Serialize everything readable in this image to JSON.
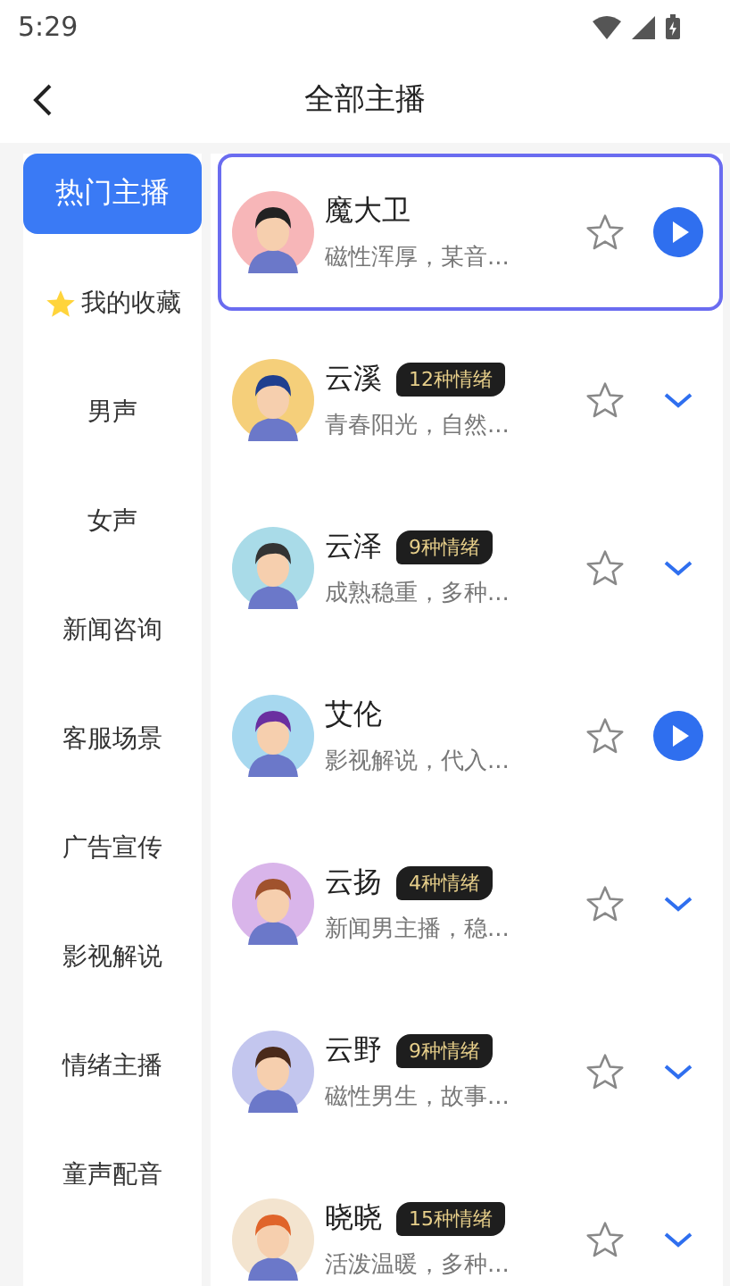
{
  "status_bar": {
    "time": "5:29"
  },
  "header": {
    "title": "全部主播"
  },
  "sidebar": {
    "items": [
      {
        "label": "热门主播",
        "selected": true,
        "kind": "plain"
      },
      {
        "label": "我的收藏",
        "selected": false,
        "kind": "favorites"
      },
      {
        "label": "男声",
        "selected": false,
        "kind": "plain"
      },
      {
        "label": "女声",
        "selected": false,
        "kind": "plain"
      },
      {
        "label": "新闻咨询",
        "selected": false,
        "kind": "plain"
      },
      {
        "label": "客服场景",
        "selected": false,
        "kind": "plain"
      },
      {
        "label": "广告宣传",
        "selected": false,
        "kind": "plain"
      },
      {
        "label": "影视解说",
        "selected": false,
        "kind": "plain"
      },
      {
        "label": "情绪主播",
        "selected": false,
        "kind": "plain"
      },
      {
        "label": "童声配音",
        "selected": false,
        "kind": "plain"
      }
    ]
  },
  "voices": [
    {
      "name": "魔大卫",
      "description": "磁性浑厚，某音...",
      "selected": true,
      "favorite": false,
      "kind": "play"
    },
    {
      "name": "云溪",
      "badge": "12种情绪",
      "description": "青春阳光，自然...",
      "selected": false,
      "favorite": false,
      "kind": "expand"
    },
    {
      "name": "云泽",
      "badge": "9种情绪",
      "description": "成熟稳重，多种...",
      "selected": false,
      "favorite": false,
      "kind": "expand"
    },
    {
      "name": "艾伦",
      "description": "影视解说，代入...",
      "selected": false,
      "favorite": false,
      "kind": "play"
    },
    {
      "name": "云扬",
      "badge": "4种情绪",
      "description": "新闻男主播，稳...",
      "selected": false,
      "favorite": false,
      "kind": "expand"
    },
    {
      "name": "云野",
      "badge": "9种情绪",
      "description": "磁性男生，故事...",
      "selected": false,
      "favorite": false,
      "kind": "expand"
    },
    {
      "name": "晓晓",
      "badge": "15种情绪",
      "description": "活泼温暖，多种...",
      "selected": false,
      "favorite": false,
      "kind": "expand"
    }
  ]
}
